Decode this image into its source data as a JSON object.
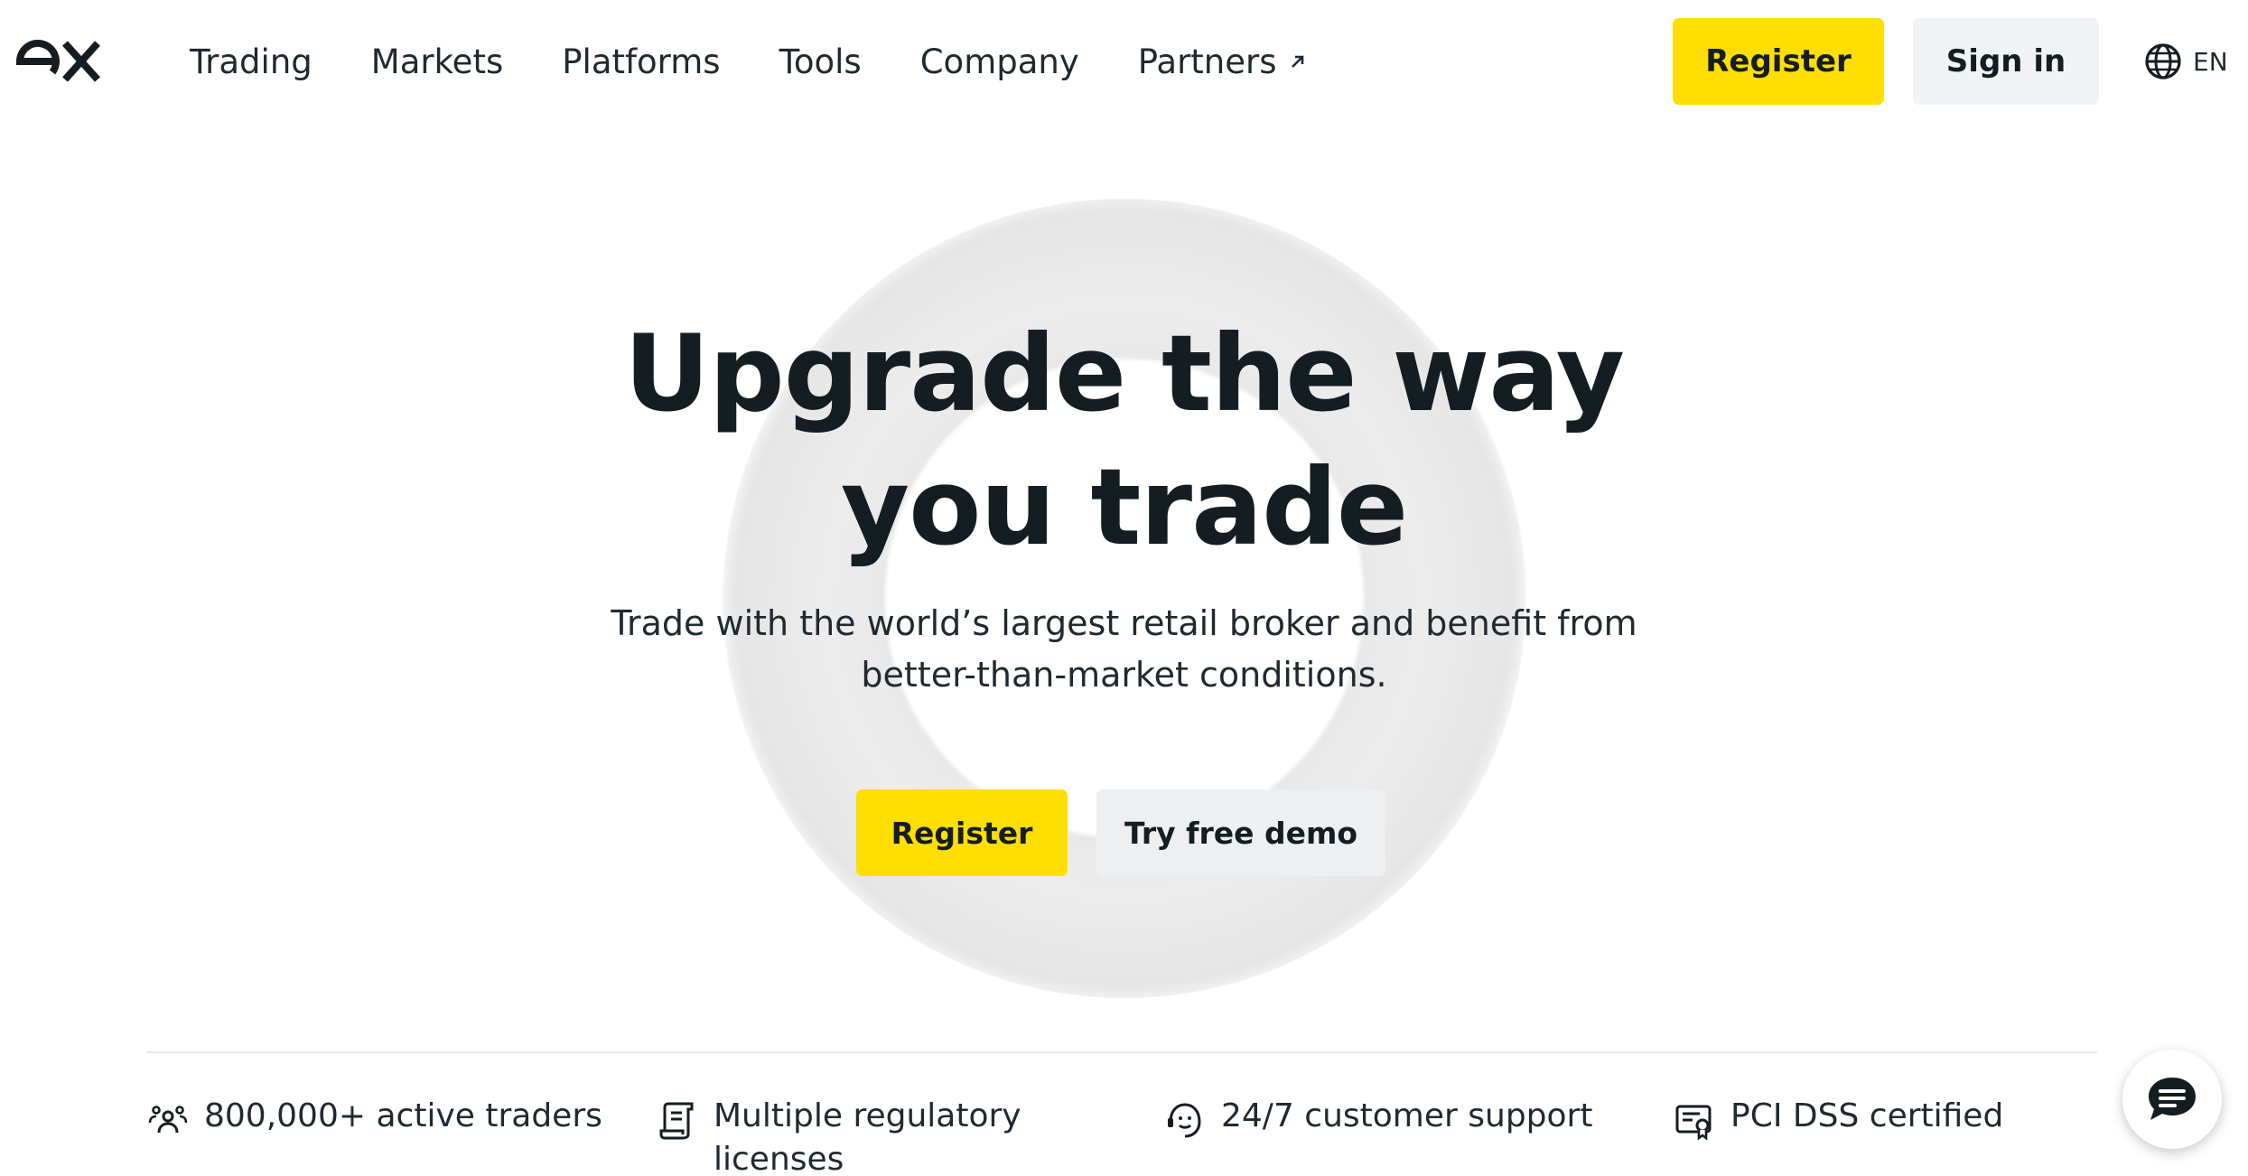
{
  "header": {
    "logo_text": "ex",
    "nav": [
      {
        "label": "Trading"
      },
      {
        "label": "Markets"
      },
      {
        "label": "Platforms"
      },
      {
        "label": "Tools"
      },
      {
        "label": "Company"
      },
      {
        "label": "Partners",
        "external": true
      }
    ],
    "register_label": "Register",
    "signin_label": "Sign in",
    "language": "EN"
  },
  "hero": {
    "title_line1": "Upgrade the way",
    "title_line2": "you trade",
    "subtitle_line1": "Trade with the world’s largest retail broker and benefit from",
    "subtitle_line2": "better-than-market conditions.",
    "register_label": "Register",
    "demo_label": "Try free demo"
  },
  "features": [
    {
      "icon": "users-icon",
      "text": "800,000+ active traders"
    },
    {
      "icon": "license-scroll-icon",
      "text": "Multiple regulatory licenses"
    },
    {
      "icon": "support-headset-icon",
      "text": "24/7 customer support"
    },
    {
      "icon": "certificate-icon",
      "text": "PCI DSS certified"
    }
  ],
  "chat": {
    "icon": "chat-icon"
  },
  "colors": {
    "accent_yellow": "#ffde02",
    "button_grey": "#f2f3f4",
    "text_dark": "#141d22",
    "ring_grey": "#e9e9ea"
  }
}
